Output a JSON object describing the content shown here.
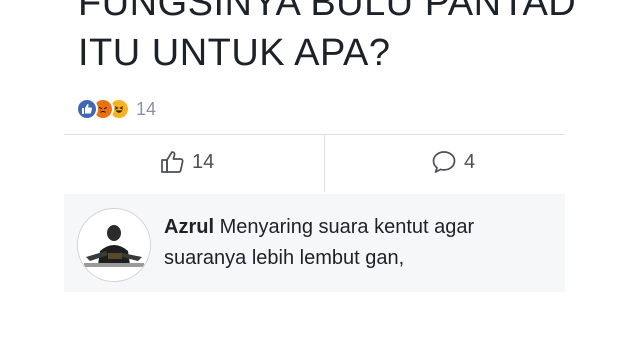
{
  "post": {
    "title_line1": "FUNGSINYA BULU PANTAD",
    "title_line2": "ITU UNTUK APA?"
  },
  "reactions": {
    "icons": [
      "like-icon",
      "angry-icon",
      "haha-icon"
    ],
    "count": "14"
  },
  "actions": {
    "like_count": "14",
    "comment_count": "4"
  },
  "comment": {
    "author": "Azrul",
    "text": "Menyaring suara kentut agar suaranya lebih lembut gan,"
  },
  "colors": {
    "like_blue": "#4267b2",
    "angry_orange": "#e9710f",
    "haha_yellow": "#f7b125",
    "comment_bg": "#f6f7f9"
  }
}
